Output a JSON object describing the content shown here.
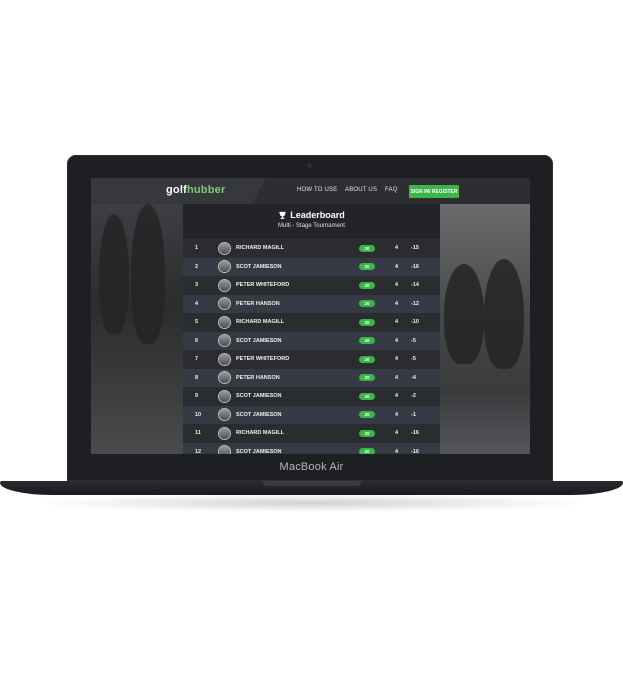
{
  "device": {
    "model": "MacBook Air"
  },
  "nav": {
    "logo_part1": "golf",
    "logo_part2": "hubber",
    "links": [
      "HOW TO USE",
      "ABOUT US",
      "FAQ"
    ],
    "signin": "SIGN IN/ REGISTER"
  },
  "leaderboard": {
    "title": "Leaderboard",
    "subtitle": "Multi - Stage Tournament",
    "rows": [
      {
        "rank": "1",
        "name": "RICHARD MAGILL",
        "score": "20",
        "stage": "4",
        "total": "-15"
      },
      {
        "rank": "2",
        "name": "SCOT JAMIESON",
        "score": "20",
        "stage": "4",
        "total": "-16"
      },
      {
        "rank": "3",
        "name": "PETER WHITEFORD",
        "score": "20",
        "stage": "4",
        "total": "-14"
      },
      {
        "rank": "4",
        "name": "PETER HANSON",
        "score": "20",
        "stage": "4",
        "total": "-12"
      },
      {
        "rank": "5",
        "name": "RICHARD MAGILL",
        "score": "20",
        "stage": "4",
        "total": "-10"
      },
      {
        "rank": "6",
        "name": "SCOT JAMIESON",
        "score": "20",
        "stage": "4",
        "total": "-5"
      },
      {
        "rank": "7",
        "name": "PETER WHITEFORD",
        "score": "20",
        "stage": "4",
        "total": "-5"
      },
      {
        "rank": "8",
        "name": "PETER HANSON",
        "score": "20",
        "stage": "4",
        "total": "-4"
      },
      {
        "rank": "9",
        "name": "SCOT JAMIESON",
        "score": "20",
        "stage": "4",
        "total": "-2"
      },
      {
        "rank": "10",
        "name": "SCOT JAMIESON",
        "score": "20",
        "stage": "4",
        "total": "-1"
      },
      {
        "rank": "11",
        "name": "RICHARD MAGILL",
        "score": "20",
        "stage": "4",
        "total": "-16"
      },
      {
        "rank": "12",
        "name": "SCOT JAMIESON",
        "score": "20",
        "stage": "4",
        "total": "-16"
      }
    ]
  },
  "colors": {
    "accent_green": "#3bb54a",
    "logo_green": "#7bc97f"
  }
}
